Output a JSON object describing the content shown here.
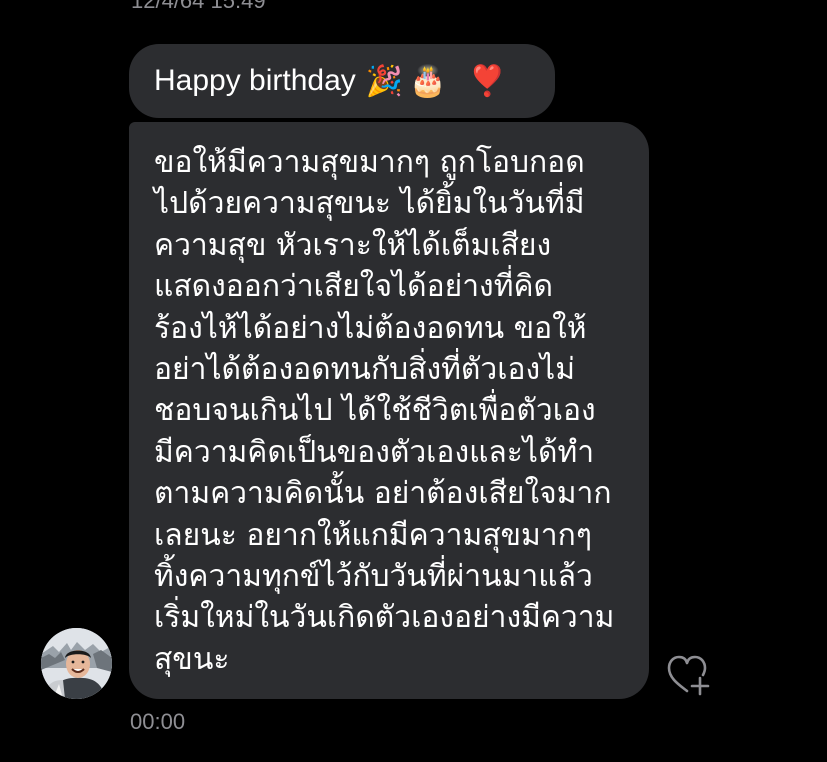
{
  "thread": {
    "top_timestamp": "12/4/64 15:49",
    "bottom_time": "00:00"
  },
  "messages": [
    {
      "text": "Happy birthday",
      "emojis": [
        "🎉",
        "🎂",
        "❣️"
      ]
    },
    {
      "lines": [
        "ขอให้มีความสุขมากๆ ถูกโอบกอด",
        "ไปด้วยความสุขนะ ได้ยิ้มในวันที่มี",
        "ความสุข หัวเราะให้ได้เต็มเสียง",
        "แสดงออกว่าเสียใจได้อย่างที่คิด",
        "ร้องไห้ได้อย่างไม่ต้องอดทน ขอให้",
        "อย่าได้ต้องอดทนกับสิ่งที่ตัวเองไม่",
        "ชอบจนเกินไป ได้ใช้ชีวิตเพื่อตัวเอง",
        "มีความคิดเป็นของตัวเองและได้ทำ",
        "ตามความคิดนั้น อย่าต้องเสียใจมาก",
        "เลยนะ อยากให้แกมีความสุขมากๆ",
        "ทิ้งความทุกข์ไว้กับวันที่ผ่านมาแล้ว",
        "เริ่มใหม่ในวันเกิดตัวเองอย่างมีความ",
        "สุขนะ"
      ]
    }
  ],
  "icons": {
    "avatar": "avatar-icon",
    "react": "heart-plus-icon"
  },
  "colors": {
    "background": "#000000",
    "bubble": "#2c2d30",
    "text": "#ffffff",
    "muted": "#8e8e93"
  }
}
